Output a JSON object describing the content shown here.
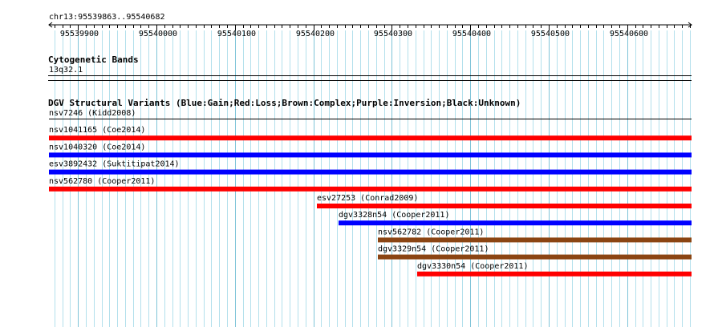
{
  "location": "chr13:95539863..95540682",
  "ruler": {
    "ticks": [
      "95539900",
      "95540000",
      "95540100",
      "95540200",
      "95540300",
      "95540400",
      "95540500",
      "95540600"
    ],
    "start": 95539863,
    "end": 95540682
  },
  "cytoband": {
    "title": "Cytogenetic Bands",
    "band": "13q32.1"
  },
  "dgv": {
    "title": "DGV Structural Variants (Blue:Gain;Red:Loss;Brown:Complex;Purple:Inversion;Black:Unknown)",
    "colors": {
      "gain": "#0000ff",
      "loss": "#ff0000",
      "complex": "#8b4513",
      "inversion": "#800080",
      "unknown": "#000000"
    },
    "variants": [
      {
        "label": "nsv7246 (Kidd2008)",
        "type": "unknown",
        "start": 95539863,
        "end": 95540682
      },
      {
        "label": "nsv1041165 (Coe2014)",
        "type": "loss",
        "start": 95539863,
        "end": 95540682
      },
      {
        "label": "nsv1040320 (Coe2014)",
        "type": "gain",
        "start": 95539863,
        "end": 95540682
      },
      {
        "label": "esv3892432 (Suktitipat2014)",
        "type": "gain",
        "start": 95539863,
        "end": 95540682
      },
      {
        "label": "nsv562780 (Cooper2011)",
        "type": "loss",
        "start": 95539863,
        "end": 95540682
      },
      {
        "label": "esv27253 (Conrad2009)",
        "type": "loss",
        "start": 95540204,
        "end": 95540682
      },
      {
        "label": "dgv3328n54 (Cooper2011)",
        "type": "gain",
        "start": 95540232,
        "end": 95540682
      },
      {
        "label": "nsv562782 (Cooper2011)",
        "type": "complex",
        "start": 95540282,
        "end": 95540682
      },
      {
        "label": "dgv3329n54 (Cooper2011)",
        "type": "complex",
        "start": 95540282,
        "end": 95540682
      },
      {
        "label": "dgv3330n54 (Cooper2011)",
        "type": "loss",
        "start": 95540332,
        "end": 95540682
      }
    ]
  }
}
